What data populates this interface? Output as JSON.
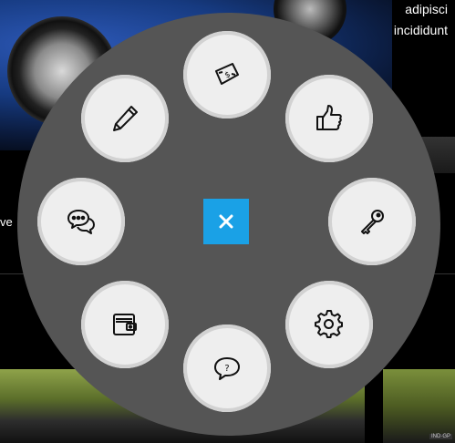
{
  "background": {
    "top_right_lines": [
      "adipisci",
      "incididunt"
    ],
    "left_fragment": "ve"
  },
  "radial_menu": {
    "items": [
      {
        "name": "money-icon"
      },
      {
        "name": "thumbs-up-icon"
      },
      {
        "name": "key-icon"
      },
      {
        "name": "gear-icon"
      },
      {
        "name": "question-bubble-icon"
      },
      {
        "name": "wallet-icon"
      },
      {
        "name": "chat-bubbles-icon"
      },
      {
        "name": "pencil-icon"
      }
    ],
    "close_icon": "close-icon",
    "colors": {
      "disc": "#555555",
      "item": "#eeeeee",
      "item_ring": "#d2d2d2",
      "close_button": "#1aa1e6"
    }
  }
}
